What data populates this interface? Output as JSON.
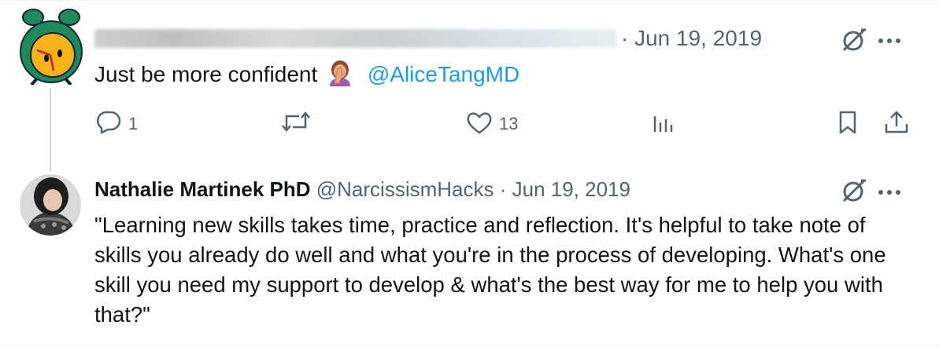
{
  "tweet1": {
    "date": "· Jun 19, 2019",
    "text": "Just be more confident",
    "mention": "@AliceTangMD",
    "stats": {
      "replies": "1",
      "likes": "13"
    }
  },
  "tweet2": {
    "display_name": "Nathalie Martinek PhD",
    "handle": "@NarcissismHacks",
    "date": "· Jun 19, 2019",
    "text": "\"Learning new skills takes time, practice and reflection. It's helpful to take note of skills you already do well and what you're in the process of developing. What's one skill you need my support to develop & what's the best way for me to help you with that?\""
  },
  "icons": {
    "grok": "grok-icon",
    "more": "more-icon",
    "reply": "reply-icon",
    "retweet": "retweet-icon",
    "like": "like-icon",
    "views": "views-icon",
    "bookmark": "bookmark-icon",
    "share": "share-icon",
    "emoji": "facepalm-emoji-icon"
  },
  "colors": {
    "link": "#1d9bf0",
    "secondary": "#536471",
    "text": "#0f1419",
    "avatar_bg": "#1e8a5c",
    "avatar_face": "#f6b21a"
  }
}
